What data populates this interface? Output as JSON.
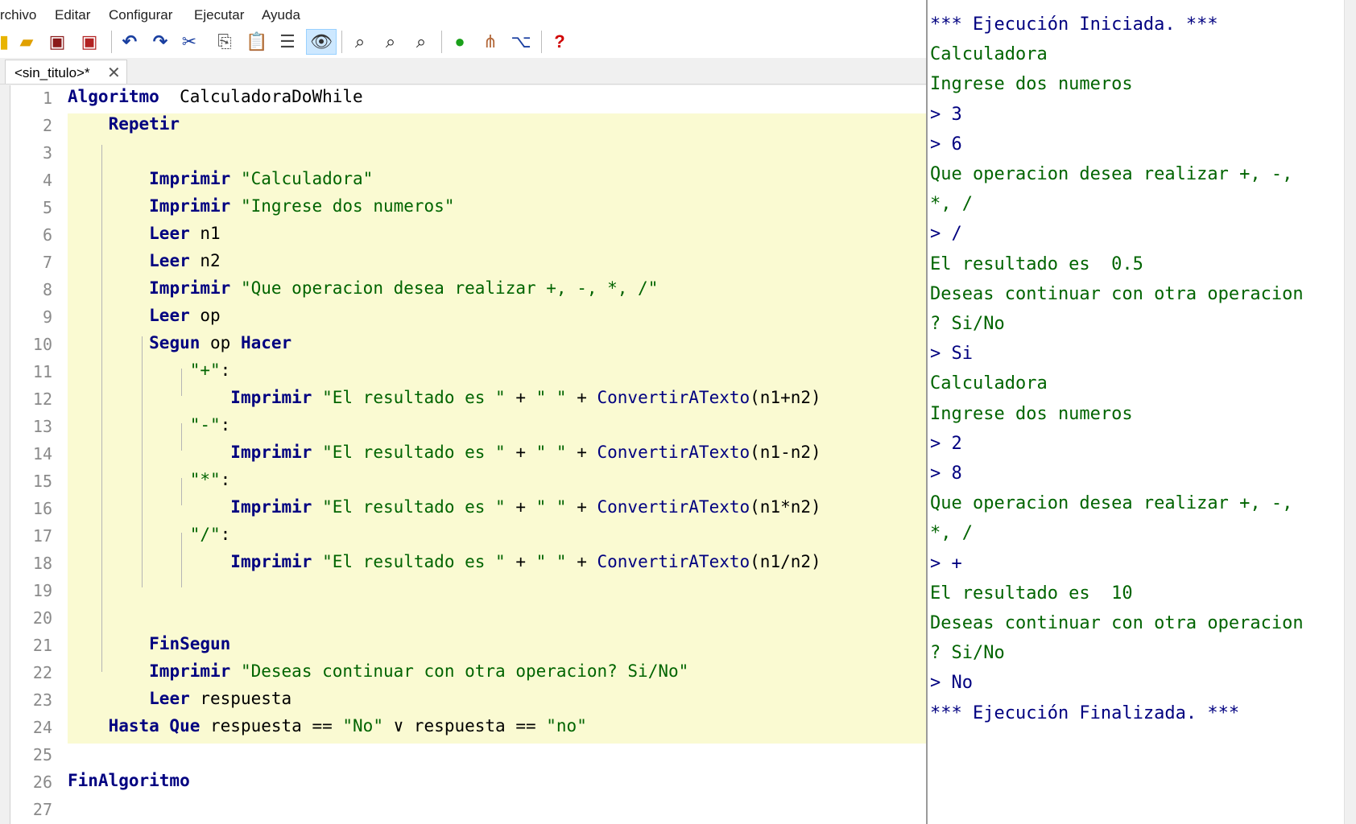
{
  "menu": {
    "items": [
      "rchivo",
      "Editar",
      "Configurar",
      "Ejecutar",
      "Ayuda"
    ]
  },
  "toolbar": {
    "icons": [
      "new-file-icon",
      "open-folder-icon",
      "save-icon",
      "save-as-icon",
      "undo-icon",
      "redo-icon",
      "cut-icon",
      "copy-icon",
      "paste-icon",
      "edit-selection-icon",
      "step-by-step-eye-icon",
      "find-icon",
      "find-previous-icon",
      "find-next-icon",
      "run-icon",
      "step-run-icon",
      "flowchart-icon",
      "help-icon"
    ]
  },
  "tab": {
    "label": "<sin_titulo>*",
    "close_symbol": "✕"
  },
  "editor": {
    "lines": [
      {
        "n": "1",
        "tokens": [
          [
            "kw",
            "Algoritmo"
          ],
          [
            "",
            "  CalculadoraDoWhile"
          ]
        ]
      },
      {
        "n": "2",
        "tokens": [
          [
            "",
            "    "
          ],
          [
            "kw",
            "Repetir"
          ]
        ]
      },
      {
        "n": "3",
        "tokens": []
      },
      {
        "n": "4",
        "tokens": [
          [
            "",
            "        "
          ],
          [
            "kw",
            "Imprimir"
          ],
          [
            "",
            " "
          ],
          [
            "st",
            "\"Calculadora\""
          ]
        ]
      },
      {
        "n": "5",
        "tokens": [
          [
            "",
            "        "
          ],
          [
            "kw",
            "Imprimir"
          ],
          [
            "",
            " "
          ],
          [
            "st",
            "\"Ingrese dos numeros\""
          ]
        ]
      },
      {
        "n": "6",
        "tokens": [
          [
            "",
            "        "
          ],
          [
            "kw",
            "Leer"
          ],
          [
            "",
            " n1"
          ]
        ]
      },
      {
        "n": "7",
        "tokens": [
          [
            "",
            "        "
          ],
          [
            "kw",
            "Leer"
          ],
          [
            "",
            " n2"
          ]
        ]
      },
      {
        "n": "8",
        "tokens": [
          [
            "",
            "        "
          ],
          [
            "kw",
            "Imprimir"
          ],
          [
            "",
            " "
          ],
          [
            "st",
            "\"Que operacion desea realizar +, -, *, /\""
          ]
        ]
      },
      {
        "n": "9",
        "tokens": [
          [
            "",
            "        "
          ],
          [
            "kw",
            "Leer"
          ],
          [
            "",
            " op"
          ]
        ]
      },
      {
        "n": "10",
        "tokens": [
          [
            "",
            "        "
          ],
          [
            "kw",
            "Segun"
          ],
          [
            "",
            " op "
          ],
          [
            "kw",
            "Hacer"
          ]
        ]
      },
      {
        "n": "11",
        "tokens": [
          [
            "",
            "            "
          ],
          [
            "st",
            "\"+\""
          ],
          [
            "",
            ":"
          ]
        ]
      },
      {
        "n": "12",
        "tokens": [
          [
            "",
            "                "
          ],
          [
            "kw",
            "Imprimir"
          ],
          [
            "",
            " "
          ],
          [
            "st",
            "\"El resultado es \""
          ],
          [
            "",
            " + "
          ],
          [
            "st",
            "\" \""
          ],
          [
            "",
            " + "
          ],
          [
            "fn",
            "ConvertirATexto"
          ],
          [
            "",
            "(n1+n2)"
          ]
        ]
      },
      {
        "n": "13",
        "tokens": [
          [
            "",
            "            "
          ],
          [
            "st",
            "\"-\""
          ],
          [
            "",
            ":"
          ]
        ]
      },
      {
        "n": "14",
        "tokens": [
          [
            "",
            "                "
          ],
          [
            "kw",
            "Imprimir"
          ],
          [
            "",
            " "
          ],
          [
            "st",
            "\"El resultado es \""
          ],
          [
            "",
            " + "
          ],
          [
            "st",
            "\" \""
          ],
          [
            "",
            " + "
          ],
          [
            "fn",
            "ConvertirATexto"
          ],
          [
            "",
            "(n1-n2)"
          ]
        ]
      },
      {
        "n": "15",
        "tokens": [
          [
            "",
            "            "
          ],
          [
            "st",
            "\"*\""
          ],
          [
            "",
            ":"
          ]
        ]
      },
      {
        "n": "16",
        "tokens": [
          [
            "",
            "                "
          ],
          [
            "kw",
            "Imprimir"
          ],
          [
            "",
            " "
          ],
          [
            "st",
            "\"El resultado es \""
          ],
          [
            "",
            " + "
          ],
          [
            "st",
            "\" \""
          ],
          [
            "",
            " + "
          ],
          [
            "fn",
            "ConvertirATexto"
          ],
          [
            "",
            "(n1*n2)"
          ]
        ]
      },
      {
        "n": "17",
        "tokens": [
          [
            "",
            "            "
          ],
          [
            "st",
            "\"/\""
          ],
          [
            "",
            ":"
          ]
        ]
      },
      {
        "n": "18",
        "tokens": [
          [
            "",
            "                "
          ],
          [
            "kw",
            "Imprimir"
          ],
          [
            "",
            " "
          ],
          [
            "st",
            "\"El resultado es \""
          ],
          [
            "",
            " + "
          ],
          [
            "st",
            "\" \""
          ],
          [
            "",
            " + "
          ],
          [
            "fn",
            "ConvertirATexto"
          ],
          [
            "",
            "(n1/n2)"
          ]
        ]
      },
      {
        "n": "19",
        "tokens": []
      },
      {
        "n": "20",
        "tokens": []
      },
      {
        "n": "21",
        "tokens": [
          [
            "",
            "        "
          ],
          [
            "kw",
            "FinSegun"
          ]
        ]
      },
      {
        "n": "22",
        "tokens": [
          [
            "",
            "        "
          ],
          [
            "kw",
            "Imprimir"
          ],
          [
            "",
            " "
          ],
          [
            "st",
            "\"Deseas continuar con otra operacion? Si/No\""
          ]
        ]
      },
      {
        "n": "23",
        "tokens": [
          [
            "",
            "        "
          ],
          [
            "kw",
            "Leer"
          ],
          [
            "",
            " respuesta"
          ]
        ]
      },
      {
        "n": "24",
        "tokens": [
          [
            "",
            "    "
          ],
          [
            "kw",
            "Hasta Que"
          ],
          [
            "",
            " respuesta == "
          ],
          [
            "st",
            "\"No\""
          ],
          [
            "",
            " ∨ respuesta == "
          ],
          [
            "st",
            "\"no\""
          ]
        ]
      },
      {
        "n": "25",
        "tokens": []
      },
      {
        "n": "26",
        "tokens": [
          [
            "kw",
            "FinAlgoritmo"
          ]
        ]
      },
      {
        "n": "27",
        "tokens": []
      }
    ]
  },
  "console": {
    "colors": {
      "banner": "#000080",
      "output": "#006400",
      "input": "#000080"
    },
    "lines": [
      {
        "t": "banner",
        "text": "*** Ejecución Iniciada. ***"
      },
      {
        "t": "output",
        "text": "Calculadora"
      },
      {
        "t": "output",
        "text": "Ingrese dos numeros"
      },
      {
        "t": "input",
        "text": "> 3"
      },
      {
        "t": "input",
        "text": "> 6"
      },
      {
        "t": "output",
        "text": "Que operacion desea realizar +, -,"
      },
      {
        "t": "output",
        "text": "*, /"
      },
      {
        "t": "input",
        "text": "> /"
      },
      {
        "t": "output",
        "text": "El resultado es  0.5"
      },
      {
        "t": "output",
        "text": "Deseas continuar con otra operacion"
      },
      {
        "t": "output",
        "text": "? Si/No"
      },
      {
        "t": "input",
        "text": "> Si"
      },
      {
        "t": "output",
        "text": "Calculadora"
      },
      {
        "t": "output",
        "text": "Ingrese dos numeros"
      },
      {
        "t": "input",
        "text": "> 2"
      },
      {
        "t": "input",
        "text": "> 8"
      },
      {
        "t": "output",
        "text": "Que operacion desea realizar +, -,"
      },
      {
        "t": "output",
        "text": "*, /"
      },
      {
        "t": "input",
        "text": "> +"
      },
      {
        "t": "output",
        "text": "El resultado es  10"
      },
      {
        "t": "output",
        "text": "Deseas continuar con otra operacion"
      },
      {
        "t": "output",
        "text": "? Si/No"
      },
      {
        "t": "input",
        "text": "> No"
      },
      {
        "t": "banner",
        "text": "*** Ejecución Finalizada. ***"
      }
    ]
  }
}
